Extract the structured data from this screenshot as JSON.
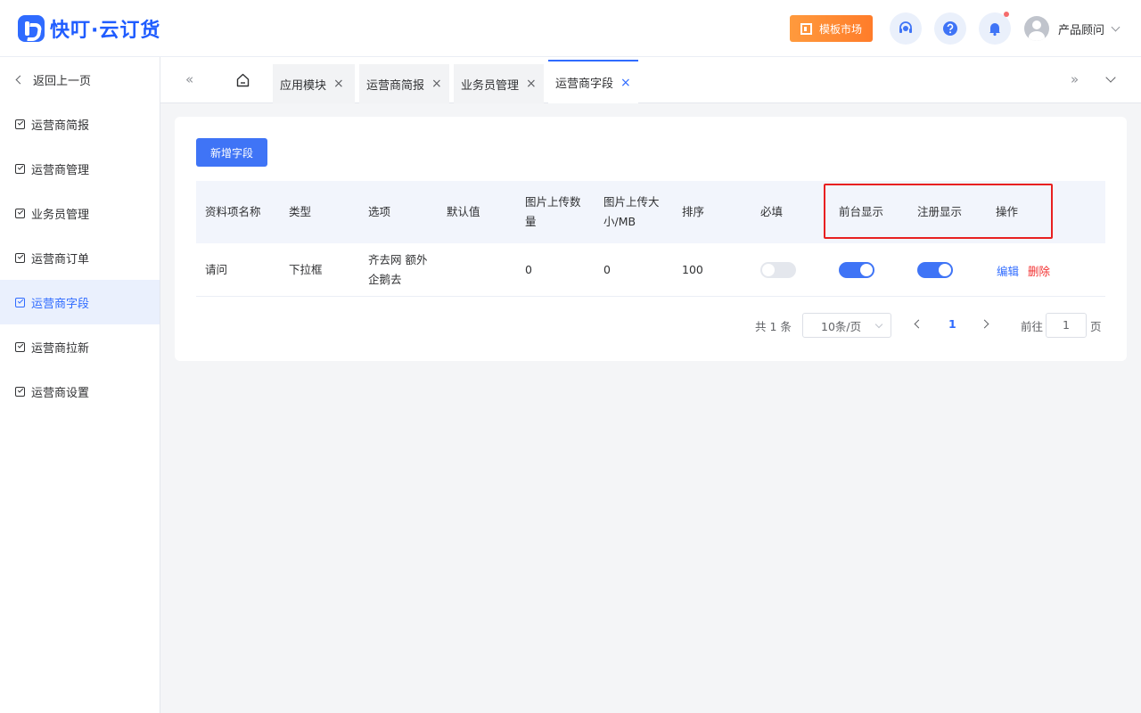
{
  "header": {
    "logo_text": "快叮·云订货",
    "template_market": "模板市场",
    "user_name": "产品顾问"
  },
  "sidebar": {
    "back": "返回上一页",
    "items": [
      {
        "label": "运营商简报"
      },
      {
        "label": "运营商管理"
      },
      {
        "label": "业务员管理"
      },
      {
        "label": "运营商订单"
      },
      {
        "label": "运营商字段",
        "active": true
      },
      {
        "label": "运营商拉新"
      },
      {
        "label": "运营商设置"
      }
    ]
  },
  "tabs": [
    {
      "label": "应用模块"
    },
    {
      "label": "运营商简报"
    },
    {
      "label": "业务员管理"
    },
    {
      "label": "运营商字段",
      "active": true
    }
  ],
  "toolbar": {
    "add_label": "新增字段"
  },
  "table": {
    "columns": [
      "资料项名称",
      "类型",
      "选项",
      "默认值",
      "图片上传数量",
      "图片上传大小/MB",
      "排序",
      "必填",
      "前台显示",
      "注册显示",
      "操作"
    ],
    "rows": [
      {
        "name": "请问",
        "type": "下拉框",
        "options": "齐去网 额外企鹅去",
        "default": "",
        "img_count": "0",
        "img_size": "0",
        "sort": "100",
        "required": false,
        "front_display": true,
        "register_display": true,
        "actions": {
          "edit": "编辑",
          "delete": "删除"
        }
      }
    ]
  },
  "pagination": {
    "total": "共 1 条",
    "page_size": "10条/页",
    "current": "1",
    "goto_label": "前往",
    "goto_value": "1",
    "page_suffix": "页"
  },
  "colors": {
    "primary": "#3f74f6",
    "danger": "#f23030",
    "highlight": "#e82020",
    "template_btn": "#ff8a33"
  }
}
